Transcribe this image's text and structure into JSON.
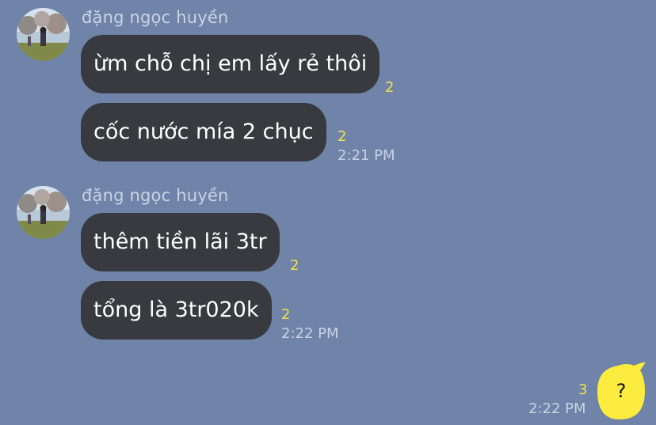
{
  "messages": {
    "group1": {
      "sender": "đặng ngọc huyền",
      "msg1": {
        "text": "ừm chỗ chị em lấy rẻ thôi",
        "read": "2"
      },
      "msg2": {
        "text": "cốc nước mía 2 chục",
        "read": "2",
        "time": "2:21 PM"
      }
    },
    "group2": {
      "sender": "đặng ngọc huyền",
      "msg1": {
        "text": "thêm tiền lãi 3tr",
        "read": "2"
      },
      "msg2": {
        "text": "tổng là 3tr020k",
        "read": "2",
        "time": "2:22 PM"
      }
    },
    "outgoing": {
      "text": "?",
      "read": "3",
      "time": "2:22 PM"
    }
  },
  "colors": {
    "background": "#6f84a8",
    "incoming_bubble": "#383a3f",
    "outgoing_bubble": "#fcec3f",
    "read_count": "#f3e04a"
  }
}
